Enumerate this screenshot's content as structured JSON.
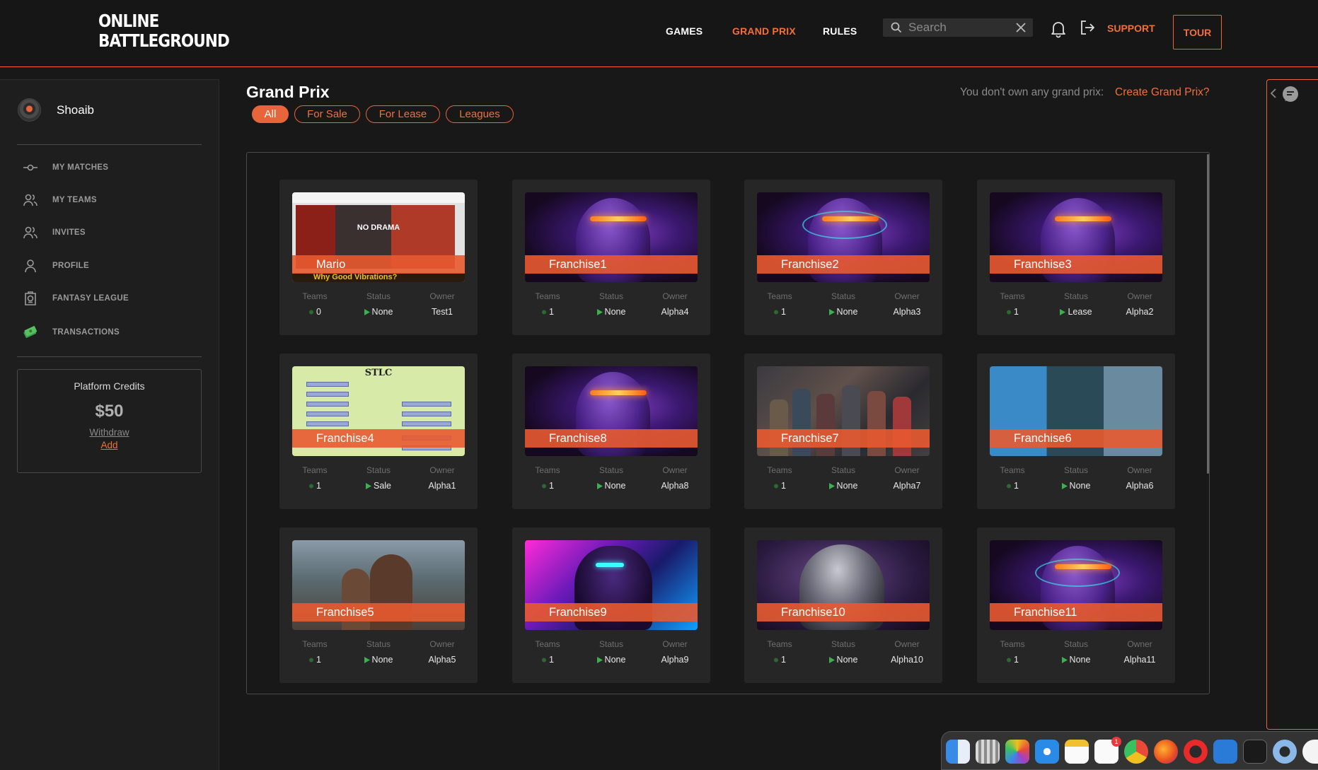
{
  "header": {
    "logo_line1": "ONLINE",
    "logo_line2": "BATTLEGROUND",
    "nav": [
      "GAMES",
      "GRAND PRIX",
      "RULES"
    ],
    "search_placeholder": "Search",
    "support": "SUPPORT",
    "tour": "TOUR",
    "accent": "#e8643a"
  },
  "sidebar": {
    "username": "Shoaib",
    "menu": [
      {
        "label": "MY MATCHES",
        "icon": "matches-icon"
      },
      {
        "label": "MY TEAMS",
        "icon": "teams-icon"
      },
      {
        "label": "INVITES",
        "icon": "invites-icon"
      },
      {
        "label": "PROFILE",
        "icon": "profile-icon"
      },
      {
        "label": "FANTASY LEAGUE",
        "icon": "fantasy-league-icon"
      },
      {
        "label": "TRANSACTIONS",
        "icon": "cash-icon"
      }
    ],
    "credits": {
      "title": "Platform Credits",
      "amount": "$50",
      "withdraw": "Withdraw",
      "add": "Add"
    }
  },
  "main": {
    "title": "Grand Prix",
    "filters": [
      "All",
      "For Sale",
      "For Lease",
      "Leagues"
    ],
    "active_filter": "All",
    "own_note": "You don't own any grand prix:",
    "create_link": "Create Grand Prix?",
    "stat_headers": [
      "Teams",
      "Status",
      "Owner"
    ],
    "cards": [
      {
        "name": "Mario",
        "teams": "0",
        "status": "None",
        "owner": "Test1"
      },
      {
        "name": "Franchise1",
        "teams": "1",
        "status": "None",
        "owner": "Alpha4"
      },
      {
        "name": "Franchise2",
        "teams": "1",
        "status": "None",
        "owner": "Alpha3"
      },
      {
        "name": "Franchise3",
        "teams": "1",
        "status": "Lease",
        "owner": "Alpha2"
      },
      {
        "name": "Franchise4",
        "teams": "1",
        "status": "Sale",
        "owner": "Alpha1"
      },
      {
        "name": "Franchise8",
        "teams": "1",
        "status": "None",
        "owner": "Alpha8"
      },
      {
        "name": "Franchise7",
        "teams": "1",
        "status": "None",
        "owner": "Alpha7"
      },
      {
        "name": "Franchise6",
        "teams": "1",
        "status": "None",
        "owner": "Alpha6"
      },
      {
        "name": "Franchise5",
        "teams": "1",
        "status": "None",
        "owner": "Alpha5"
      },
      {
        "name": "Franchise9",
        "teams": "1",
        "status": "None",
        "owner": "Alpha9"
      },
      {
        "name": "Franchise10",
        "teams": "1",
        "status": "None",
        "owner": "Alpha10"
      },
      {
        "name": "Franchise11",
        "teams": "1",
        "status": "None",
        "owner": "Alpha11"
      }
    ],
    "thumb_texts": {
      "mario_banner": "NO DRAMA",
      "mario_caption": "Why Good Vibrations?",
      "stlc_title": "STLC"
    }
  },
  "dock": {
    "apps": [
      "finder-icon",
      "launchpad-icon",
      "photos-icon",
      "safari-icon",
      "notes-icon",
      "reminders-icon",
      "chrome-icon",
      "firefox-icon",
      "opera-icon",
      "vscode-icon",
      "terminal-icon",
      "quicktime-icon",
      "clock-icon"
    ],
    "reminders_badge": "1"
  }
}
